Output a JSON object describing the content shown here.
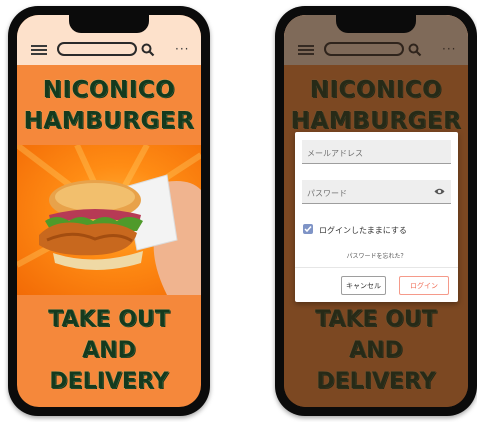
{
  "app": {
    "brand_line1": "NICONICO",
    "brand_line2": "HAMBURGER",
    "tagline_line1": "TAKE OUT",
    "tagline_line2": "AND",
    "tagline_line3": "DELIVERY"
  },
  "toolbar": {
    "menu_icon": "menu-icon",
    "search_icon": "search-icon",
    "more_icon": "more-icon",
    "more_glyph": "···"
  },
  "login_dialog": {
    "email_placeholder": "メールアドレス",
    "password_placeholder": "パスワード",
    "remember_label": "ログインしたままにする",
    "remember_checked": true,
    "forgot_link": "パスワードを忘れた？",
    "cancel_label": "キャンセル",
    "login_label": "ログイン"
  },
  "colors": {
    "screen_bg": "#f5883b",
    "topbar_bg": "#fde1cb",
    "title_text": "#153a1e",
    "login_accent": "#f06c55",
    "checkbox": "#7f94c6"
  }
}
